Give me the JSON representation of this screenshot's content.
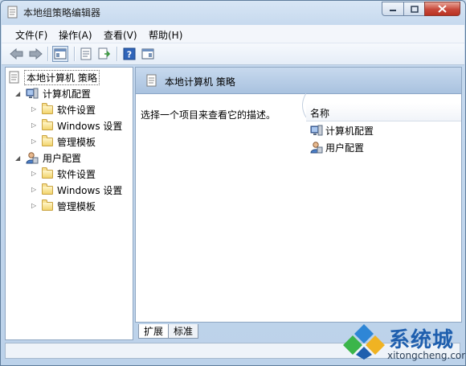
{
  "window": {
    "title": "本地组策略编辑器"
  },
  "menu": {
    "items": [
      "文件(F)",
      "操作(A)",
      "查看(V)",
      "帮助(H)"
    ]
  },
  "toolbar": {
    "buttons": [
      "back-icon",
      "forward-icon",
      "show-hide-tree-icon",
      "properties-icon",
      "export-list-icon",
      "help-icon",
      "show-hide-action-pane-icon"
    ]
  },
  "tree": {
    "root": "本地计算机 策略",
    "computer_config": "计算机配置",
    "user_config": "用户配置",
    "children": [
      "软件设置",
      "Windows 设置",
      "管理模板"
    ]
  },
  "content": {
    "header_title": "本地计算机 策略",
    "description": "选择一个项目来查看它的描述。",
    "column_name": "名称",
    "items": [
      "计算机配置",
      "用户配置"
    ]
  },
  "tabs": [
    "扩展",
    "标准"
  ],
  "watermark": {
    "brand": "系统城",
    "url": "xitongcheng.com"
  },
  "colors": {
    "accent": "#1f5fae",
    "title_bar": "#c6d9ee",
    "close_button": "#c7483a"
  }
}
